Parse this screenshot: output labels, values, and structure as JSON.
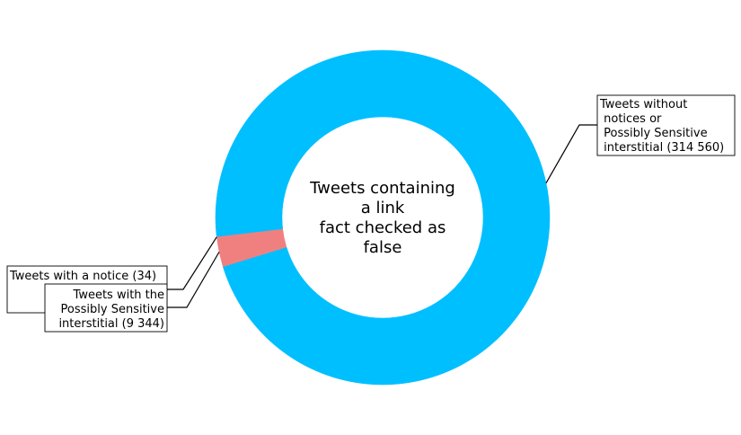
{
  "chart_data": {
    "type": "pie",
    "style": "donut",
    "title": "Tweets containing a link fact checked as false",
    "center_text": [
      "Tweets containing",
      "a link",
      "fact checked as",
      "false"
    ],
    "slices": [
      {
        "name": "Tweets without notices or Possibly Sensitive interstitial",
        "value": 314560,
        "color": "#00BFFF",
        "label_lines": [
          "Tweets without",
          " notices or",
          " Possibly Sensitive",
          " interstitial (314 560)"
        ]
      },
      {
        "name": "Tweets with a notice",
        "value": 34,
        "color": "#00BFFF",
        "label_lines": [
          "Tweets with a notice (34)"
        ]
      },
      {
        "name": "Tweets with the Possibly Sensitive interstitial",
        "value": 9344,
        "color": "#F08080",
        "label_lines": [
          "Tweets with the",
          " Possibly Sensitive",
          " interstitial (9 344)"
        ]
      }
    ]
  }
}
